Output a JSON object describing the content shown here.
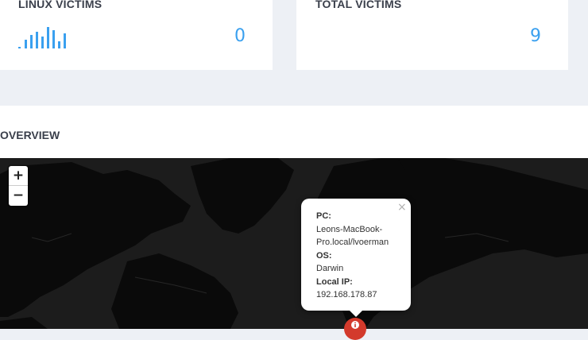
{
  "cards": {
    "linux": {
      "title": "LINUX VICTIMS",
      "value": "0"
    },
    "total": {
      "title": "TOTAL VICTIMS",
      "value": "9"
    }
  },
  "overview": {
    "title": "OVERVIEW"
  },
  "map": {
    "zoom_in": "+",
    "zoom_out": "−",
    "popup": {
      "close": "×",
      "pc_label": "PC:",
      "pc_value_line1": "Leons-MacBook-",
      "pc_value_line2": "Pro.local/lvoerman",
      "os_label": "OS:",
      "os_value": "Darwin",
      "ip_label": "Local IP:",
      "ip_value": "192.168.178.87"
    },
    "marker_icon": "info-icon"
  },
  "colors": {
    "accent": "#3aa0ef",
    "marker": "#d33a2c",
    "map_bg": "#1c1c1c",
    "land": "#0b0b0b"
  }
}
